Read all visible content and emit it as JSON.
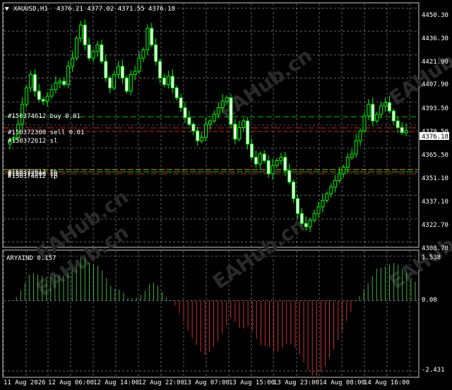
{
  "header": {
    "arrow": "▼",
    "symbol": "XAUUSD,H1",
    "ohlc": "4376.21 4377.02 4371.55 4376.18"
  },
  "price_axis": {
    "ticks": [
      "4450.30",
      "4436.30",
      "4421.90",
      "4407.90",
      "4393.50",
      "4379.50",
      "4365.50",
      "4351.10",
      "4337.10",
      "4322.70",
      "4308.70"
    ],
    "current_price": "4376.18"
  },
  "indicator": {
    "name": "ARYAIND 0.157",
    "ticks": [
      "1.538",
      "0.00",
      "-2.431"
    ]
  },
  "time_axis": {
    "labels": [
      "11 Aug 2026",
      "12 Aug 06:00",
      "12 Aug 14:00",
      "12 Aug 22:00",
      "13 Aug 07:00",
      "13 Aug 15:00",
      "13 Aug 23:00",
      "14 Aug 08:00",
      "14 Aug 16:00"
    ]
  },
  "orders": {
    "upper": [
      "#150374612 buy 0.01",
      "#150372308 sell 0.01",
      "#150372612 sl"
    ],
    "lower": [
      "#150372612 tp",
      "#150372308 tp",
      "#150374612 tp"
    ]
  },
  "colors": {
    "bull": "#00ff00",
    "bear": "#ff2a2a",
    "grid": "#a0a0a0",
    "hist_up": "#3cb43c",
    "hist_down": "#d03030",
    "buy_line": "#00c000",
    "sell_line": "#d02020",
    "tp_line": "#e0a000"
  },
  "watermark": "EAHub.cn",
  "chart_data": {
    "type": "candlestick",
    "ylim": [
      4306.0,
      4453.0
    ],
    "indicator_ylim": [
      -2.6,
      1.7
    ],
    "candles_note": "close prices per hourly bar, left to right",
    "closes": [
      4370.5,
      4372.0,
      4380.0,
      4392.0,
      4402.0,
      4410.0,
      4400.0,
      4395.0,
      4394.0,
      4397.0,
      4401.0,
      4405.0,
      4406.0,
      4404.0,
      4415.0,
      4420.0,
      4432.0,
      4440.0,
      4428.0,
      4420.0,
      4424.0,
      4428.0,
      4418.0,
      4408.0,
      4402.0,
      4410.0,
      4415.0,
      4408.0,
      4400.0,
      4410.0,
      4412.0,
      4420.0,
      4425.0,
      4438.0,
      4428.0,
      4418.0,
      4408.0,
      4404.0,
      4409.0,
      4402.0,
      4396.0,
      4390.0,
      4384.0,
      4380.0,
      4376.0,
      4370.0,
      4372.0,
      4380.0,
      4382.0,
      4386.0,
      4390.0,
      4394.0,
      4396.0,
      4380.0,
      4371.0,
      4378.0,
      4382.0,
      4368.0,
      4360.0,
      4356.0,
      4362.0,
      4358.0,
      4350.0,
      4355.0,
      4358.0,
      4360.0,
      4352.0,
      4345.0,
      4335.0,
      4326.0,
      4320.0,
      4318.0,
      4322.0,
      4326.0,
      4330.0,
      4334.0,
      4338.0,
      4342.0,
      4346.0,
      4350.0,
      4354.0,
      4360.0,
      4362.0,
      4370.0,
      4376.0,
      4385.0,
      4392.0,
      4382.0,
      4386.0,
      4391.0,
      4393.0,
      4388.0,
      4382.0,
      4378.0,
      4375.0,
      4376.2
    ],
    "indicator_values": "derived histogram, positive = green, negative = red"
  }
}
